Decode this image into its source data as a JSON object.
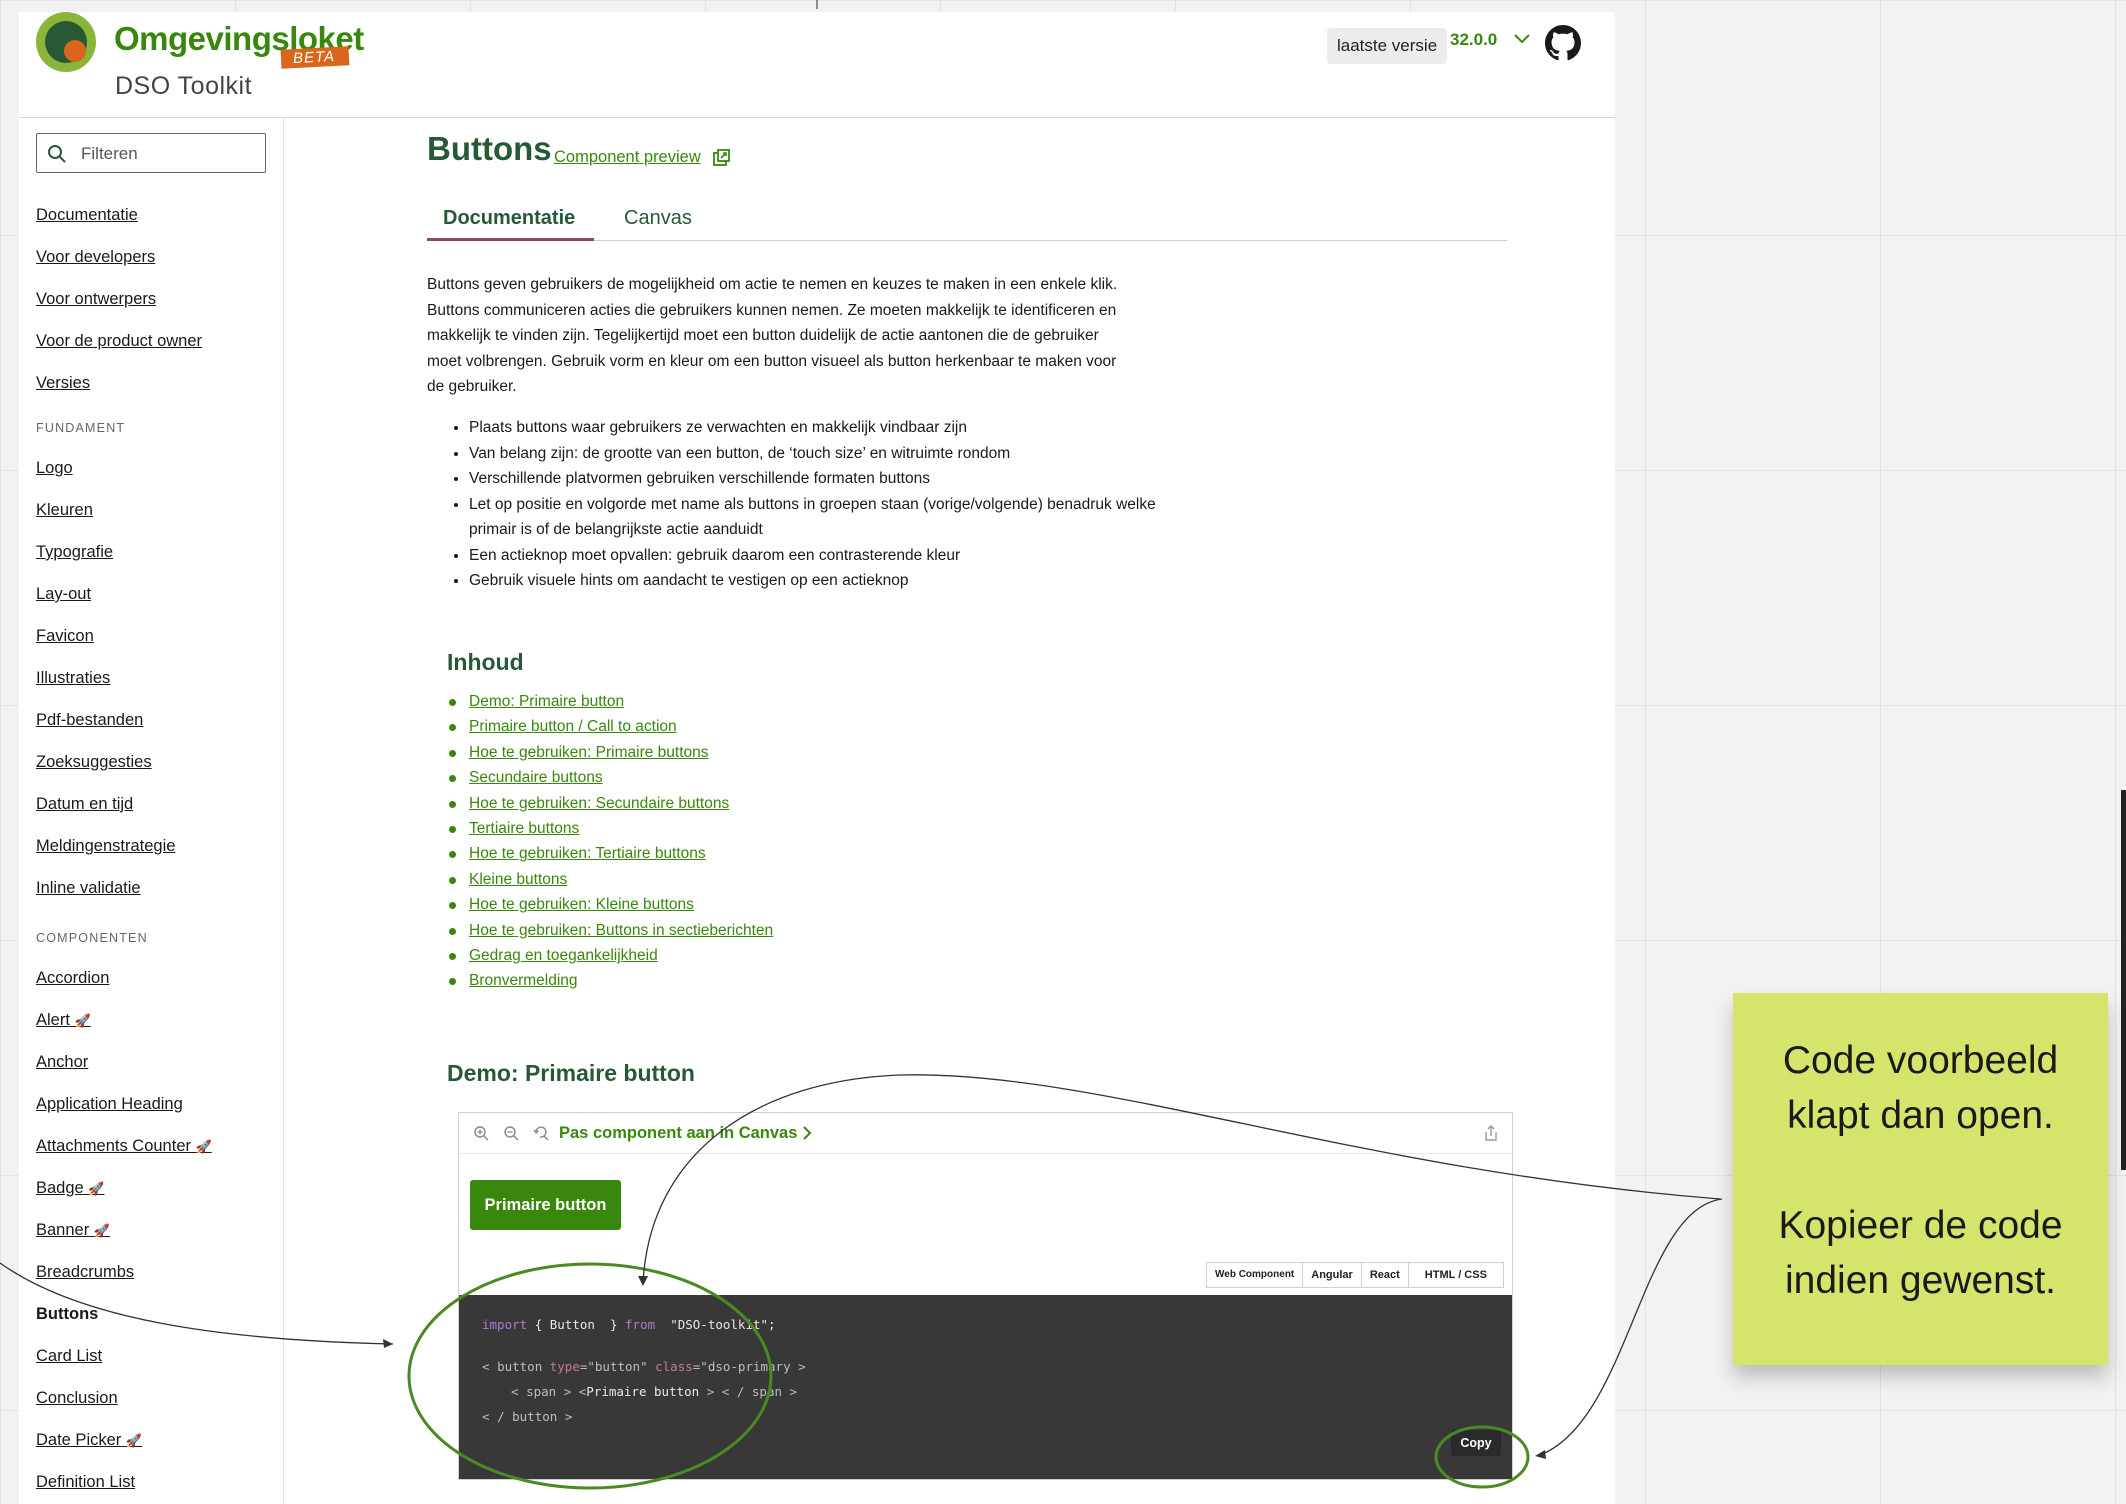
{
  "header": {
    "brand": "Omgevingsloket",
    "beta": "BETA",
    "subtitle": "DSO Toolkit",
    "version_label": "laatste versie",
    "version_number": "32.0.0"
  },
  "sidebar": {
    "filter_placeholder": "Filteren",
    "top_items": [
      "Documentatie",
      "Voor developers",
      "Voor ontwerpers",
      "Voor de product owner",
      "Versies"
    ],
    "section_fundament": "FUNDAMENT",
    "fundament_items": [
      "Logo",
      "Kleuren",
      "Typografie",
      "Lay-out",
      "Favicon",
      "Illustraties",
      "Pdf-bestanden",
      "Zoeksuggesties",
      "Datum en tijd",
      "Meldingenstrategie",
      "Inline validatie"
    ],
    "section_componenten": "COMPONENTEN",
    "componenten_items": [
      "Accordion",
      "Alert",
      "Anchor",
      "Application Heading",
      "Attachments Counter",
      "Badge",
      "Banner",
      "Breadcrumbs",
      "Buttons",
      "Card List",
      "Conclusion",
      "Date Picker",
      "Definition List"
    ],
    "active_item": "Buttons",
    "rocket": "🚀"
  },
  "main": {
    "title": "Buttons",
    "preview_link": "Component preview",
    "tabs": [
      "Documentatie",
      "Canvas"
    ],
    "intro_lines": [
      "Buttons geven gebruikers de mogelijkheid om actie te nemen en keuzes te maken in een enkele klik.",
      "Buttons communiceren acties die gebruikers kunnen nemen. Ze moeten makkelijk te identificeren en",
      "makkelijk te vinden zijn. Tegelijkertijd moet een button duidelijk de actie aantonen die de gebruiker",
      "moet volbrengen. Gebruik vorm en kleur om een button visueel als button herkenbaar te maken voor",
      "de gebruiker."
    ],
    "bullets": [
      "Plaats buttons waar gebruikers ze verwachten en makkelijk vindbaar zijn",
      "Van belang zijn: de grootte van een button, de ‘touch size’ en witruimte rondom",
      "Verschillende platvormen gebruiken verschillende formaten buttons",
      "Let op positie en volgorde met name als buttons in groepen staan (vorige/volgende) benadruk welke primair is of de belangrijkste actie aanduidt",
      "Een actieknop moet opvallen: gebruik daarom een contrasterende kleur",
      "Gebruik visuele hints om aandacht te vestigen op een actieknop"
    ],
    "toc_title": "Inhoud",
    "toc": [
      "Demo: Primaire button",
      "Primaire button / Call to action",
      "Hoe te gebruiken: Primaire buttons",
      "Secundaire buttons",
      "Hoe te gebruiken: Secundaire buttons",
      "Tertiaire buttons",
      "Hoe te gebruiken: Tertiaire buttons",
      "Kleine buttons",
      "Hoe te gebruiken: Kleine buttons",
      "Hoe te gebruiken: Buttons in sectieberichten",
      "Gedrag en toegankelijkheid",
      "Bronvermelding"
    ],
    "demo_title": "Demo: Primaire button"
  },
  "demo": {
    "canvas_link": "Pas component aan in Canvas",
    "primary_button": "Primaire button",
    "code_tabs": [
      "Web Component",
      "Angular",
      "React",
      "HTML / CSS"
    ],
    "code": {
      "import_kw": "import",
      "import_brace_open": "{",
      "import_name": "Button",
      "import_brace_close": "}",
      "from_kw": "from",
      "module": "\"DSO-toolkit\";",
      "lt": "<",
      "gt": ">",
      "slash": "/",
      "button_tag": "button",
      "type_attr": "type",
      "type_val": "=\"button\"",
      "class_attr": "class",
      "class_val": "=\"dso-primary",
      "span_tag": "span",
      "inner_text": "Primaire button"
    },
    "copy_label": "Copy"
  },
  "sticky_note": {
    "text": "Code voorbeeld\nklapt dan open.\n\nKopieer de code\nindien gewenst."
  },
  "colors": {
    "brand_green": "#39870c",
    "dark_green": "#275937",
    "accent_orange": "#d9661c",
    "sticky_yellow": "#d5e46a",
    "code_bg": "#383838"
  }
}
